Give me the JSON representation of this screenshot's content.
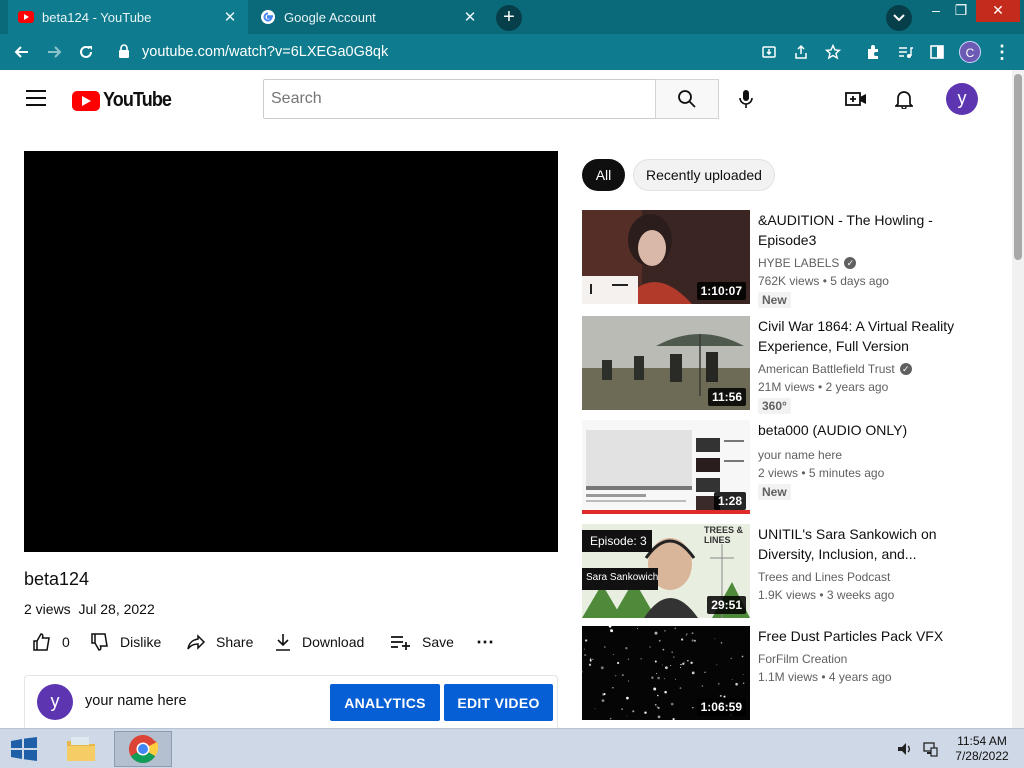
{
  "browser": {
    "tabs": [
      {
        "title": "beta124 - YouTube",
        "active": true
      },
      {
        "title": "Google Account",
        "active": false
      }
    ],
    "url": "youtube.com/watch?v=6LXEGa0G8qk",
    "profile_initial": "C"
  },
  "yt": {
    "logo_text": "YouTube",
    "search_placeholder": "Search",
    "avatar_initial": "y"
  },
  "video": {
    "title": "beta124",
    "views": "2 views",
    "date": "Jul 28, 2022",
    "likes": "0",
    "dislike_label": "Dislike",
    "share_label": "Share",
    "download_label": "Download",
    "save_label": "Save"
  },
  "channel": {
    "avatar_initial": "y",
    "name": "your name here",
    "analytics_label": "ANALYTICS",
    "edit_label": "EDIT VIDEO"
  },
  "chips": [
    "All",
    "Recently uploaded"
  ],
  "suggestions": [
    {
      "title": "&AUDITION - The Howling - Episode3",
      "channel": "HYBE LABELS",
      "verified": true,
      "stats": "762K views • 5 days ago",
      "badge": "New",
      "duration": "1:10:07"
    },
    {
      "title": "Civil War 1864: A Virtual Reality Experience, Full Version",
      "channel": "American Battlefield Trust",
      "verified": true,
      "stats": "21M views • 2 years ago",
      "badge": "360°",
      "duration": "11:56"
    },
    {
      "title": "beta000 (AUDIO ONLY)",
      "channel": "your name here",
      "verified": false,
      "stats": "2 views • 5 minutes ago",
      "badge": "New",
      "duration": "1:28"
    },
    {
      "title": "UNITIL's Sara Sankowich on Diversity, Inclusion, and...",
      "channel": "Trees and Lines Podcast",
      "verified": false,
      "stats": "1.9K views • 3 weeks ago",
      "badge": "",
      "duration": "29:51",
      "overlay_episode": "Episode: 3",
      "overlay_name": "Sara Sankowich",
      "overlay_brand": "TREES & LINES"
    },
    {
      "title": "Free Dust Particles Pack VFX",
      "channel": "ForFilm Creation",
      "verified": false,
      "stats": "1.1M views • 4 years ago",
      "badge": "",
      "duration": "1:06:59"
    }
  ],
  "taskbar": {
    "time": "11:54 AM",
    "date": "7/28/2022"
  },
  "colors": {
    "chrome_frame": "#0b6a7a",
    "yt_red": "#ff0000",
    "button_blue": "#065fd4",
    "avatar_purple": "#5e35b1"
  }
}
